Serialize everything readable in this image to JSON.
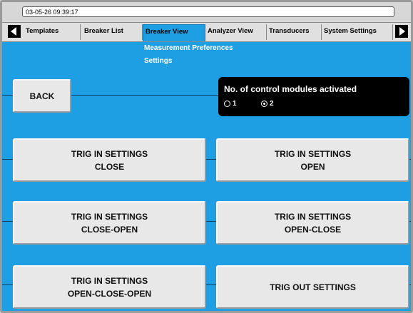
{
  "status": {
    "datetime": "03-05-26 09:39:17"
  },
  "tabs": [
    {
      "label": "Templates",
      "active": false
    },
    {
      "label": "Breaker List",
      "active": false
    },
    {
      "label": "Breaker View",
      "active": true
    },
    {
      "label": "Analyzer View",
      "active": false
    },
    {
      "label": "Transducers",
      "active": false
    },
    {
      "label": "System Settings",
      "active": false
    }
  ],
  "submenu": {
    "line1": "Measurement Preferences",
    "line2": "Settings"
  },
  "back_button": "BACK",
  "control_modules": {
    "title": "No. of control modules activated",
    "options": [
      {
        "label": "1",
        "selected": false
      },
      {
        "label": "2",
        "selected": true
      }
    ]
  },
  "buttons": {
    "trig_in_close": "TRIG IN SETTINGS\nCLOSE",
    "trig_in_open": "TRIG IN SETTINGS\nOPEN",
    "trig_in_close_open": "TRIG IN SETTINGS\nCLOSE-OPEN",
    "trig_in_open_close": "TRIG IN SETTINGS\nOPEN-CLOSE",
    "trig_in_open_close_open": "TRIG IN SETTINGS\nOPEN-CLOSE-OPEN",
    "trig_out": "TRIG OUT SETTINGS"
  },
  "colors": {
    "background": "#1e9fe4",
    "panel": "#000000",
    "button": "#e8e8e8"
  },
  "icons": {
    "left": "arrow-left-icon",
    "right": "arrow-right-icon"
  }
}
